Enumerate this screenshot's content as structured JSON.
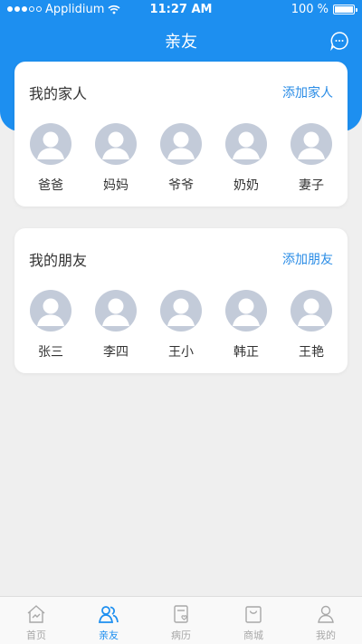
{
  "status": {
    "carrier": "Applidium",
    "time": "11:27 AM",
    "battery": "100 %",
    "battery_level": 1.0
  },
  "header": {
    "title": "亲友"
  },
  "family": {
    "title": "我的家人",
    "action": "添加家人",
    "members": [
      {
        "name": "爸爸"
      },
      {
        "name": "妈妈"
      },
      {
        "name": "爷爷"
      },
      {
        "name": "奶奶"
      },
      {
        "name": "妻子"
      }
    ]
  },
  "friends": {
    "title": "我的朋友",
    "action": "添加朋友",
    "members": [
      {
        "name": "张三"
      },
      {
        "name": "李四"
      },
      {
        "name": "王小"
      },
      {
        "name": "韩正"
      },
      {
        "name": "王艳"
      }
    ]
  },
  "tabbar": {
    "items": [
      {
        "label": "首页",
        "icon": "home-icon"
      },
      {
        "label": "亲友",
        "icon": "friends-icon"
      },
      {
        "label": "病历",
        "icon": "medical-record-icon"
      },
      {
        "label": "商城",
        "icon": "shop-icon"
      },
      {
        "label": "我的",
        "icon": "profile-icon"
      }
    ],
    "active_index": 1
  },
  "colors": {
    "primary": "#1d8ff0",
    "link": "#2a8ce6",
    "avatar_placeholder": "#c3cbd9",
    "background": "#efefef"
  }
}
